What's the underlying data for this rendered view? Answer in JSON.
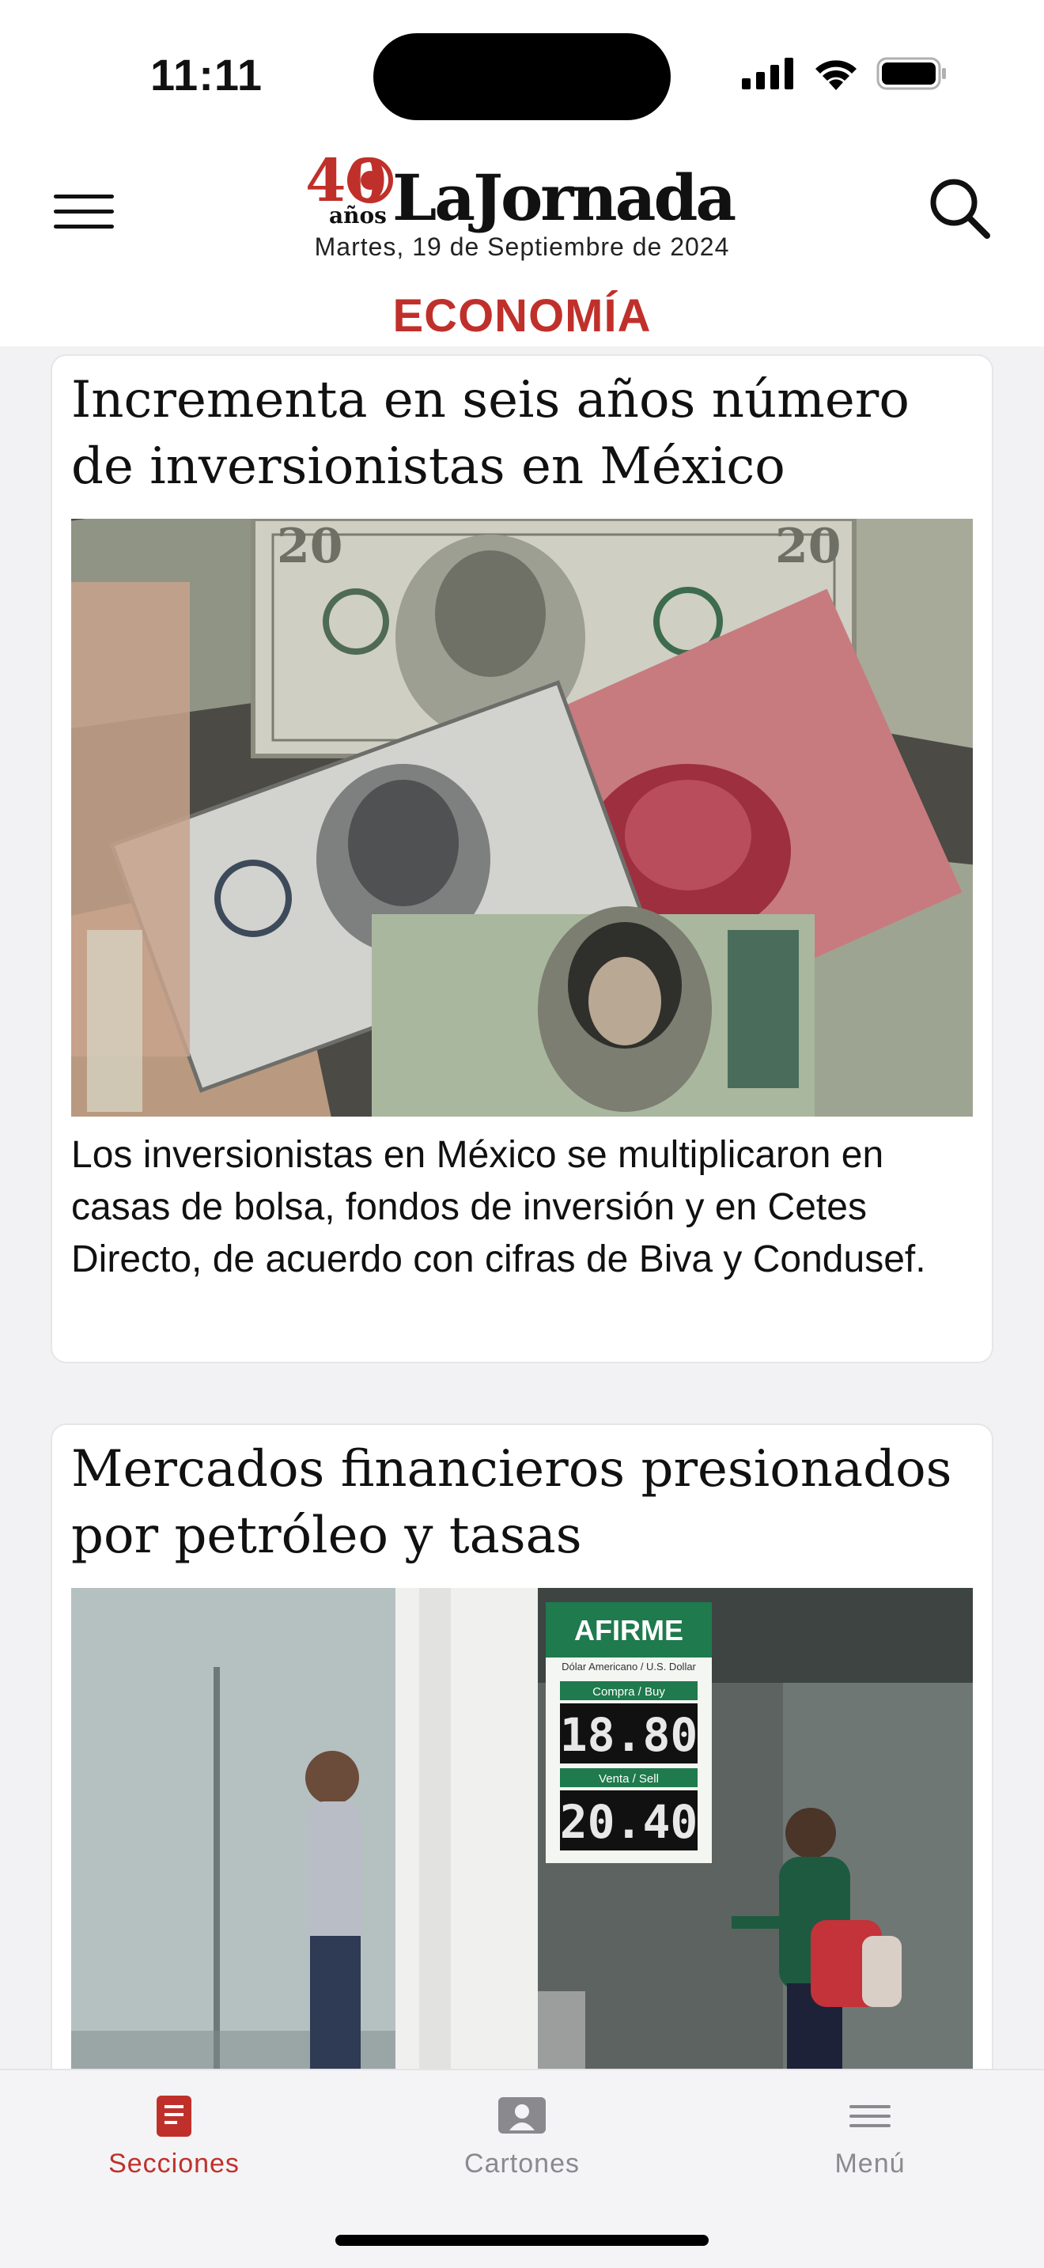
{
  "status_bar": {
    "time": "11:11",
    "icons": [
      "cellular-icon",
      "wifi-icon",
      "battery-icon"
    ]
  },
  "header": {
    "logo_number": "40",
    "logo_years": "años",
    "logo_name": "LaJornada",
    "date": "Martes, 19 de Septiembre de 2024",
    "section": "ECONOMÍA"
  },
  "articles": [
    {
      "title": "Incrementa en seis años número de inversionistas en México",
      "summary": "Los inversionistas en México se multiplicaron en casas de bolsa, fondos de inversión y en Cetes Directo, de acuerdo con cifras de Biva y Condusef.",
      "image": "banknotes-photo"
    },
    {
      "title": "Mercados financieros presionados por petróleo y tasas",
      "image": "exchange-office-photo",
      "sign": {
        "brand": "AFIRME",
        "subtitle": "Dólar Americano / U.S. Dollar",
        "buy_label": "Compra / Buy",
        "buy_value": "18.80",
        "sell_label": "Venta / Sell",
        "sell_value": "20.40"
      }
    }
  ],
  "tabbar": {
    "items": [
      {
        "label": "Secciones",
        "icon": "book-icon",
        "active": true
      },
      {
        "label": "Cartones",
        "icon": "cartoon-icon",
        "active": false
      },
      {
        "label": "Menú",
        "icon": "menu-lines-icon",
        "active": false
      }
    ]
  },
  "colors": {
    "accent": "#c0302b",
    "inactive": "#8a8a8e"
  }
}
